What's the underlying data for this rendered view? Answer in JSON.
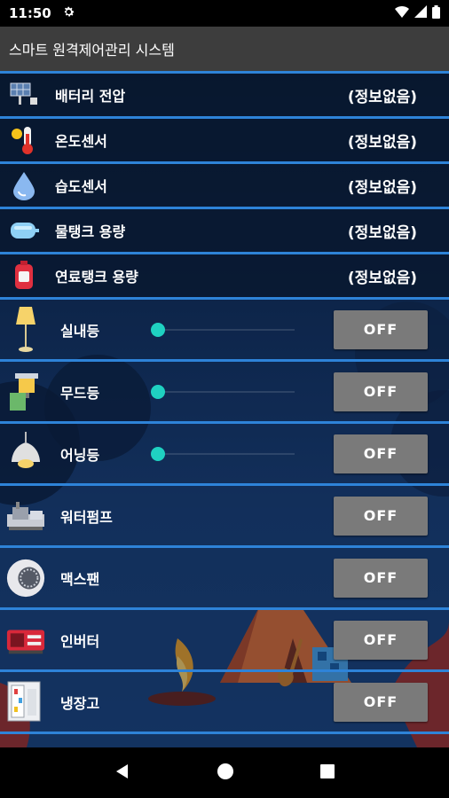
{
  "status_bar": {
    "time": "11:50",
    "settings_icon": "gear-icon",
    "wifi_icon": "wifi-icon",
    "signal_icon": "signal-icon",
    "battery_icon": "battery-icon"
  },
  "app_bar": {
    "title": "스마트 원격제어관리 시스템"
  },
  "sensors": [
    {
      "label": "배터리 전압",
      "value": "(정보없음)",
      "icon": "solar-panel-icon"
    },
    {
      "label": "온도센서",
      "value": "(정보없음)",
      "icon": "thermometer-icon"
    },
    {
      "label": "습도센서",
      "value": "(정보없음)",
      "icon": "water-drop-icon"
    },
    {
      "label": "물탱크 용량",
      "value": "(정보없음)",
      "icon": "water-tank-icon"
    },
    {
      "label": "연료탱크 용량",
      "value": "(정보없음)",
      "icon": "fuel-tank-icon"
    }
  ],
  "controls": [
    {
      "label": "실내등",
      "state": "OFF",
      "icon": "floor-lamp-icon",
      "slider_level": 0
    },
    {
      "label": "무드등",
      "state": "OFF",
      "icon": "mood-lamp-icon",
      "slider_level": 0
    },
    {
      "label": "어닝등",
      "state": "OFF",
      "icon": "pendant-lamp-icon",
      "slider_level": 0
    },
    {
      "label": "워터펌프",
      "state": "OFF",
      "icon": "water-pump-icon"
    },
    {
      "label": "맥스팬",
      "state": "OFF",
      "icon": "fan-icon"
    },
    {
      "label": "인버터",
      "state": "OFF",
      "icon": "inverter-icon"
    },
    {
      "label": "냉장고",
      "state": "OFF",
      "icon": "refrigerator-icon"
    }
  ],
  "nav_bar": {
    "back_icon": "back-icon",
    "home_icon": "home-icon",
    "recents_icon": "recents-icon"
  },
  "colors": {
    "accent_line": "#2e83d8",
    "slider_thumb": "#1fd1c1",
    "toggle_bg": "#7a7a7a",
    "app_bar": "#3d3d3d"
  }
}
